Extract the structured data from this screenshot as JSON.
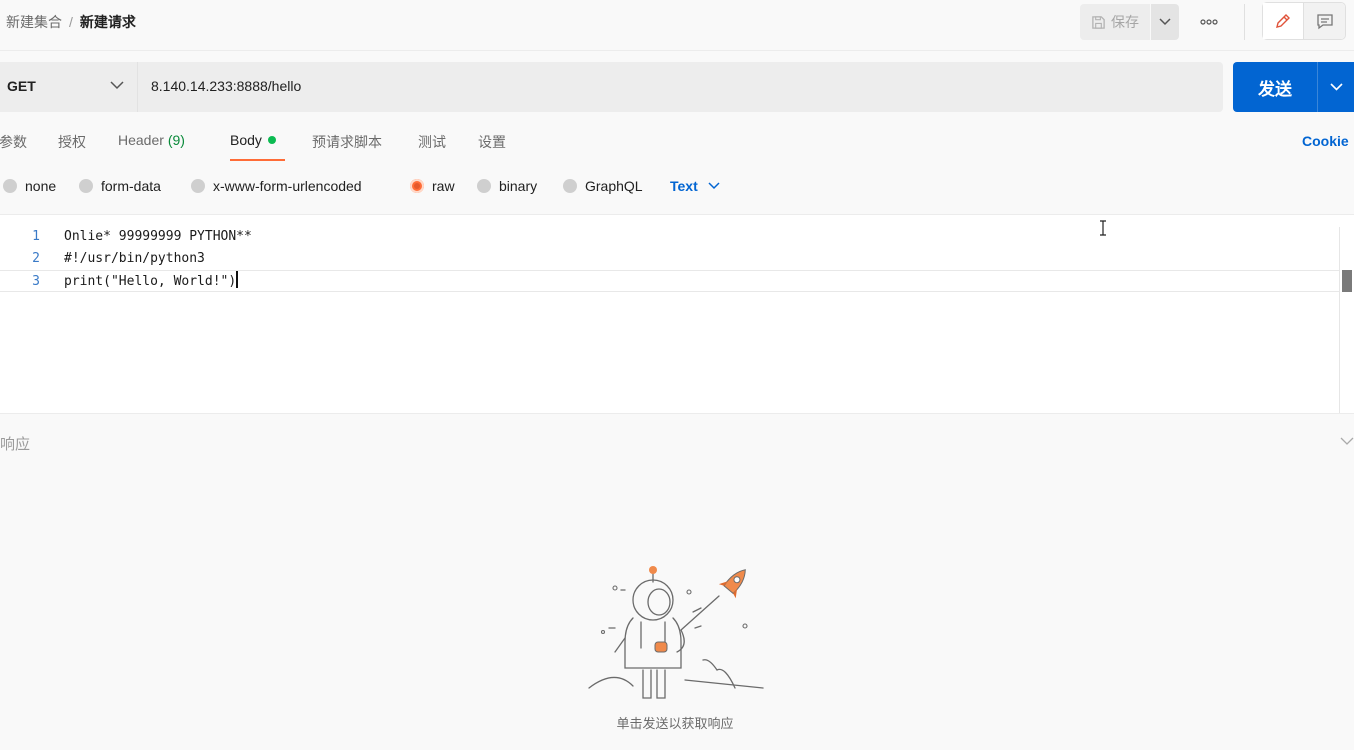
{
  "breadcrumb": {
    "parent": "新建集合",
    "separator": "/",
    "current": "新建请求"
  },
  "toolbar": {
    "save_label": "保存",
    "more_label": "ooo"
  },
  "request": {
    "method": "GET",
    "url": "8.140.14.233:8888/hello"
  },
  "send": {
    "label": "发送"
  },
  "tabs": [
    {
      "label": "参数"
    },
    {
      "label": "授权"
    },
    {
      "label": "Header",
      "count": "(9)"
    },
    {
      "label": "Body"
    },
    {
      "label": "预请求脚本"
    },
    {
      "label": "测试"
    },
    {
      "label": "设置"
    }
  ],
  "cookie_label": "Cookie",
  "body_types": [
    {
      "label": "none",
      "selected": false
    },
    {
      "label": "form-data",
      "selected": false
    },
    {
      "label": "x-www-form-urlencoded",
      "selected": false
    },
    {
      "label": "raw",
      "selected": true
    },
    {
      "label": "binary",
      "selected": false
    },
    {
      "label": "GraphQL",
      "selected": false
    }
  ],
  "raw_format": "Text",
  "editor": {
    "lines": [
      {
        "no": "1",
        "text": "Onlie* 99999999 PYTHON**"
      },
      {
        "no": "2",
        "text": "#!/usr/bin/python3"
      },
      {
        "no": "3",
        "text": "print(\"Hello, World!\")"
      }
    ]
  },
  "response": {
    "title": "响应",
    "empty_hint": "单击发送以获取响应"
  },
  "colors": {
    "accent": "#ff6c37",
    "primary": "#0265d2",
    "active_dot": "#0cbb52"
  }
}
